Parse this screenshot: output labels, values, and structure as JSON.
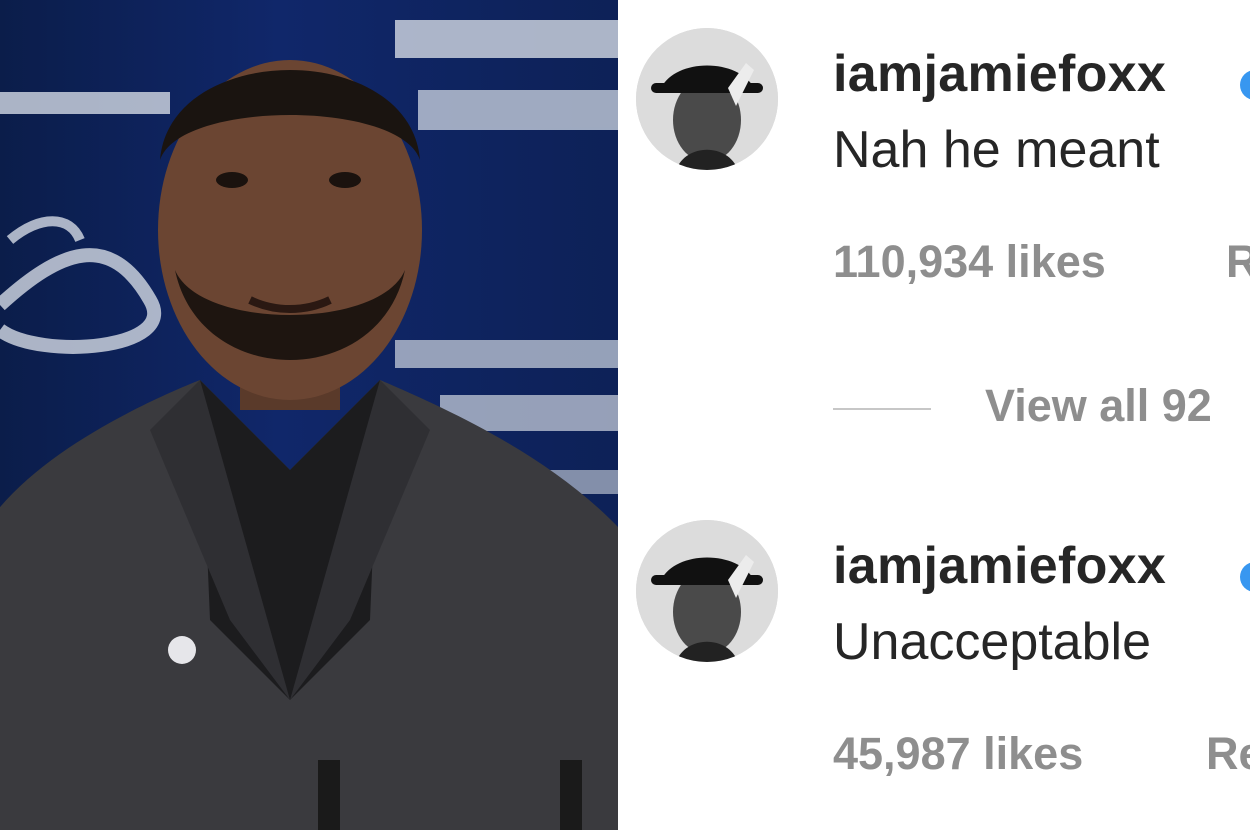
{
  "comments": [
    {
      "username": "iamjamiefoxx",
      "text": "Nah he meant",
      "likes": "110,934 likes",
      "reply": "R",
      "avatar_icon": "person-in-hat-avatar"
    },
    {
      "username": "iamjamiefoxx",
      "text": "Unacceptable",
      "likes": "45,987 likes",
      "reply": "Re",
      "avatar_icon": "person-in-hat-avatar"
    }
  ],
  "view_replies": "View all 92",
  "colors": {
    "text_primary": "#262626",
    "text_secondary": "#8e8e8e",
    "verified_blue": "#3897f0",
    "photo_background": "#10276a",
    "suit": "#3a3a3e"
  }
}
